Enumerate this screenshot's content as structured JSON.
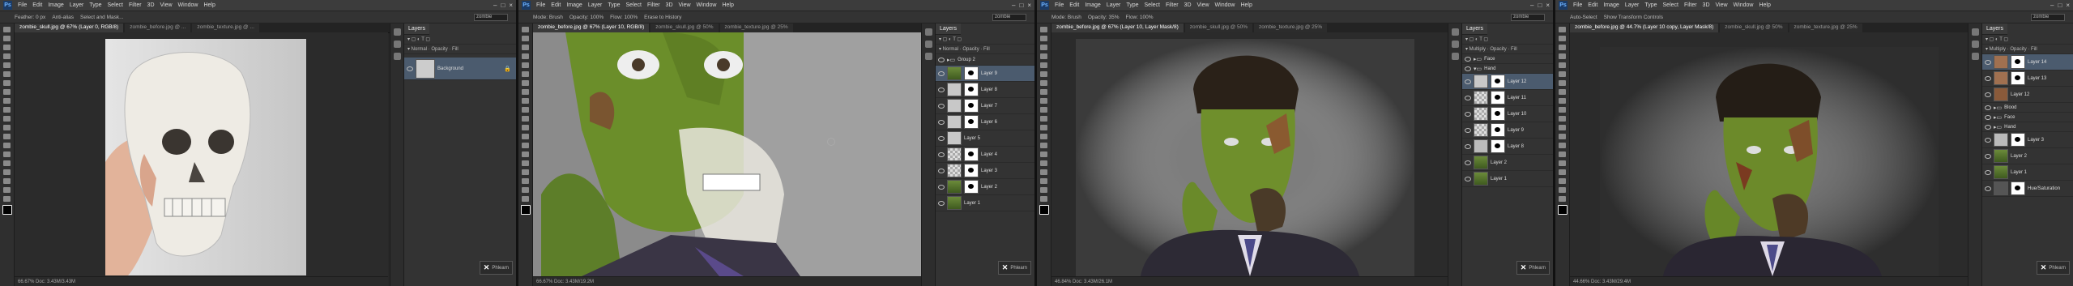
{
  "menus": [
    "File",
    "Edit",
    "Image",
    "Layer",
    "Type",
    "Select",
    "Filter",
    "3D",
    "View",
    "Window",
    "Help"
  ],
  "frames": [
    {
      "options": [
        "Feather: 0 px",
        "Anti-alias",
        "Select and Mask..."
      ],
      "tabs": [
        "zombie_skull.jpg @ 67% (Layer 0, RGB/8)",
        "zombie_before.jpg @ ...",
        "zombie_texture.jpg @ ..."
      ],
      "search": "zombie",
      "status": "66.67%   Doc: 3.43M/3.43M",
      "panel_title": "Layers",
      "layers": [
        "Background"
      ]
    },
    {
      "options": [
        "Mode: Brush",
        "Opacity: 100%",
        "Flow: 100%",
        "Erase to History"
      ],
      "tabs": [
        "zombie_before.jpg @ 67% (Layer 10, RGB/8)",
        "zombie_skull.jpg @ 50%",
        "zombie_texture.jpg @ 25%"
      ],
      "search": "zombie",
      "status": "66.67%   Doc: 3.43M/19.2M",
      "panel_title": "Layers",
      "layers": [
        "Group 2",
        "Layer 9",
        "Layer 8",
        "Layer 7",
        "Layer 6",
        "Layer 5",
        "Layer 4",
        "Layer 3",
        "Layer 2",
        "Layer 1"
      ]
    },
    {
      "options": [
        "Mode: Brush",
        "Opacity: 35%",
        "Flow: 100%"
      ],
      "tabs": [
        "zombie_before.jpg @ 67% (Layer 10, Layer Mask/8)",
        "zombie_skull.jpg @ 50%",
        "zombie_texture.jpg @ 25%"
      ],
      "search": "zombie",
      "status": "46.84%   Doc: 3.43M/26.1M",
      "panel_title": "Layers",
      "layers": [
        "Face",
        "Hand",
        "Layer 12",
        "Layer 11",
        "Layer 10",
        "Layer 9",
        "Layer 8",
        "Layer 2",
        "Layer 1"
      ]
    },
    {
      "options": [
        "Auto-Select",
        "Show Transform Controls"
      ],
      "tabs": [
        "zombie_before.jpg @ 44.7% (Layer 10 copy, Layer Mask/8)",
        "zombie_skull.jpg @ 50%",
        "zombie_texture.jpg @ 25%"
      ],
      "search": "zombie",
      "status": "44.66%   Doc: 3.43M/29.4M",
      "panel_title": "Layers",
      "layers": [
        "Layer 14",
        "Layer 13",
        "Layer 12",
        "Blood",
        "Face",
        "Hand",
        "Layer 3",
        "Layer 2",
        "Layer 1",
        "Hue/Saturation"
      ]
    }
  ],
  "watermark": "Phlearn"
}
